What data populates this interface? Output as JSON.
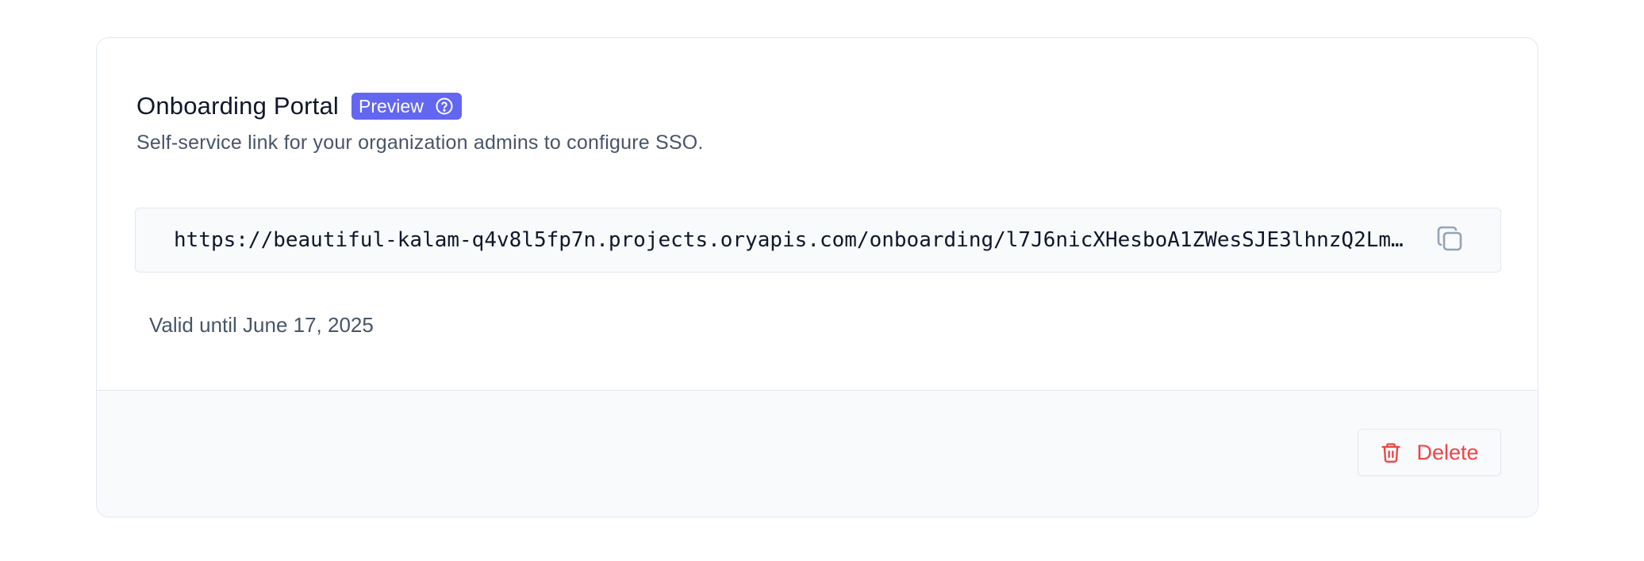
{
  "portal": {
    "title": "Onboarding Portal",
    "badge_label": "Preview",
    "badge_icon": "question-circle-icon",
    "subtitle": "Self-service link for your organization admins to configure SSO.",
    "link_url": "https://beautiful-kalam-q4v8l5fp7n.projects.oryapis.com/onboarding/l7J6nicXHesboA1ZWesSJE3lhnzQ2Lm…",
    "copy_icon": "copy-icon",
    "valid_until": "Valid until June 17, 2025"
  },
  "footer": {
    "delete_label": "Delete",
    "delete_icon": "trash-icon"
  },
  "colors": {
    "accent": "#6366f1",
    "danger": "#ef4444",
    "text_primary": "#0f172a",
    "text_secondary": "#475569",
    "border": "#e2e8f0",
    "surface_muted": "#f8fafc"
  }
}
